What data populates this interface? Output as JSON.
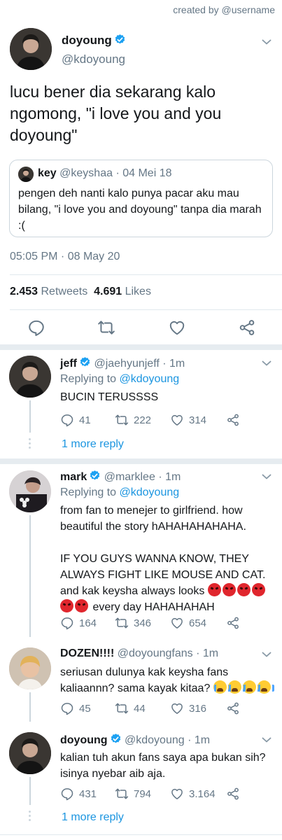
{
  "credit": "created by @username",
  "colors": {
    "accent": "#1b95e0",
    "verified": "#1da1f2",
    "muted": "#657786",
    "divider": "#e1e8ed"
  },
  "tweet": {
    "name": "doyoung",
    "handle": "@kdoyoung",
    "text": "lucu bener dia sekarang kalo ngomong, \"i love you and you doyoung\"",
    "quote": {
      "name": "key",
      "handle": "@keyshaa",
      "date": "· 04 Mei 18",
      "text": "pengen deh nanti kalo punya pacar aku mau bilang, \"i love you and doyoung\" tanpa dia marah :("
    },
    "timestamp": "05:05 PM · 08 May 20",
    "retweets_count": "2.453",
    "retweets_label": "Retweets",
    "likes_count": "4.691",
    "likes_label": "Likes",
    "actions": [
      "reply-icon",
      "retweet-icon",
      "like-icon",
      "share-icon"
    ]
  },
  "replies": [
    {
      "name": "jeff",
      "handle": "@jaehyunjeff",
      "time": "· 1m",
      "replying_prefix": "Replying to",
      "replying_to": "@kdoyoung",
      "text": "BUCIN TERUSSSS",
      "reply_count": "41",
      "retweet_count": "222",
      "like_count": "314",
      "more": "1 more reply"
    },
    {
      "name": "mark",
      "handle": "@marklee",
      "time": "· 1m",
      "replying_prefix": "Replying to",
      "replying_to": "@kdoyoung",
      "text1": "from fan to menejer to girlfriend. how beautiful the story hAHAHAHAHAHA.",
      "text2": "IF YOU GUYS WANNA KNOW, THEY ALWAYS FIGHT LIKE MOUSE AND CAT. and kak keysha always looks",
      "text2_end": "every day HAHAHAHAH",
      "emoji": "angry-face",
      "reply_count": "164",
      "retweet_count": "346",
      "like_count": "654"
    },
    {
      "name": "DOZEN!!!!",
      "handle": "@doyoungfans",
      "time": "· 1m",
      "text": "seriusan dulunya kak keysha fans kaliaannn? sama kayak kitaa?",
      "emoji": "loudly-crying-face",
      "reply_count": "45",
      "retweet_count": "44",
      "like_count": "316"
    },
    {
      "name": "doyoung",
      "handle": "@kdoyoung",
      "time": "· 1m",
      "text": "kalian tuh akun fans saya apa bukan sih? isinya nyebar aib aja.",
      "reply_count": "431",
      "retweet_count": "794",
      "like_count": "3.164",
      "more": "1 more reply"
    }
  ]
}
